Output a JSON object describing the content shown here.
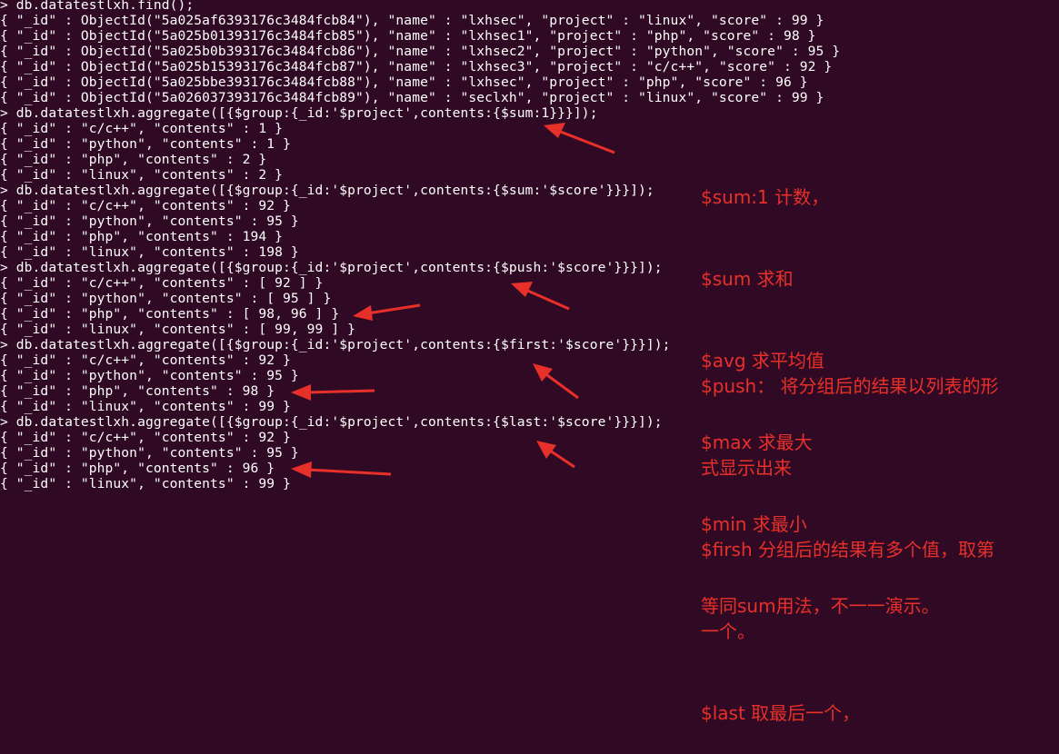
{
  "terminal": {
    "lines": [
      "> db.datatestlxh.find();",
      "{ \"_id\" : ObjectId(\"5a025af6393176c3484fcb84\"), \"name\" : \"lxhsec\", \"project\" : \"linux\", \"score\" : 99 }",
      "{ \"_id\" : ObjectId(\"5a025b01393176c3484fcb85\"), \"name\" : \"lxhsec1\", \"project\" : \"php\", \"score\" : 98 }",
      "{ \"_id\" : ObjectId(\"5a025b0b393176c3484fcb86\"), \"name\" : \"lxhsec2\", \"project\" : \"python\", \"score\" : 95 }",
      "{ \"_id\" : ObjectId(\"5a025b15393176c3484fcb87\"), \"name\" : \"lxhsec3\", \"project\" : \"c/c++\", \"score\" : 92 }",
      "{ \"_id\" : ObjectId(\"5a025bbe393176c3484fcb88\"), \"name\" : \"lxhsec\", \"project\" : \"php\", \"score\" : 96 }",
      "{ \"_id\" : ObjectId(\"5a026037393176c3484fcb89\"), \"name\" : \"seclxh\", \"project\" : \"linux\", \"score\" : 99 }",
      "> db.datatestlxh.aggregate([{$group:{_id:'$project',contents:{$sum:1}}}]);",
      "{ \"_id\" : \"c/c++\", \"contents\" : 1 }",
      "{ \"_id\" : \"python\", \"contents\" : 1 }",
      "{ \"_id\" : \"php\", \"contents\" : 2 }",
      "{ \"_id\" : \"linux\", \"contents\" : 2 }",
      "> db.datatestlxh.aggregate([{$group:{_id:'$project',contents:{$sum:'$score'}}}]);",
      "{ \"_id\" : \"c/c++\", \"contents\" : 92 }",
      "{ \"_id\" : \"python\", \"contents\" : 95 }",
      "{ \"_id\" : \"php\", \"contents\" : 194 }",
      "{ \"_id\" : \"linux\", \"contents\" : 198 }",
      "> db.datatestlxh.aggregate([{$group:{_id:'$project',contents:{$push:'$score'}}}]);",
      "{ \"_id\" : \"c/c++\", \"contents\" : [ 92 ] }",
      "{ \"_id\" : \"python\", \"contents\" : [ 95 ] }",
      "{ \"_id\" : \"php\", \"contents\" : [ 98, 96 ] }",
      "{ \"_id\" : \"linux\", \"contents\" : [ 99, 99 ] }",
      "> db.datatestlxh.aggregate([{$group:{_id:'$project',contents:{$first:'$score'}}}]);",
      "{ \"_id\" : \"c/c++\", \"contents\" : 92 }",
      "{ \"_id\" : \"python\", \"contents\" : 95 }",
      "{ \"_id\" : \"php\", \"contents\" : 98 }",
      "{ \"_id\" : \"linux\", \"contents\" : 99 }",
      "> db.datatestlxh.aggregate([{$group:{_id:'$project',contents:{$last:'$score'}}}]);",
      "{ \"_id\" : \"c/c++\", \"contents\" : 92 }",
      "{ \"_id\" : \"python\", \"contents\" : 95 }",
      "{ \"_id\" : \"php\", \"contents\" : 96 }",
      "{ \"_id\" : \"linux\", \"contents\" : 99 }"
    ]
  },
  "annotations": {
    "block1": [
      "$sum:1 计数，",
      "$sum 求和",
      "$avg 求平均值",
      "$max 求最大",
      "$min 求最小",
      "等同sum用法，不一一演示。"
    ],
    "block2": [
      "$push： 将分组后的结果以列表的形",
      "式显示出来",
      "$firsh 分组后的结果有多个值，取第",
      "一个。",
      "$last 取最后一个，"
    ]
  },
  "colors": {
    "background": "#300a24",
    "text": "#ffffff",
    "annotation": "#e8302a"
  }
}
